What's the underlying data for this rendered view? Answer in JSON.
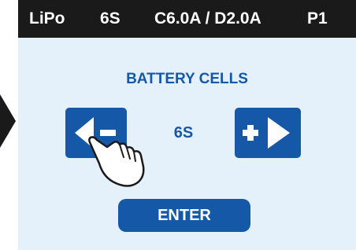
{
  "status_bar": {
    "battery_type": "LiPo",
    "cells": "6S",
    "current": "C6.0A / D2.0A",
    "program": "P1"
  },
  "main": {
    "title": "BATTERY CELLS",
    "value": "6S",
    "enter_label": "ENTER",
    "decrement_icon": "left-triangle-minus-icon",
    "increment_icon": "plus-right-triangle-icon",
    "pointer_icon": "pointing-hand-icon"
  },
  "colors": {
    "accent": "#1658a8",
    "screen_background": "#e4f1fb",
    "status_bar_background": "#1a1a1a"
  }
}
